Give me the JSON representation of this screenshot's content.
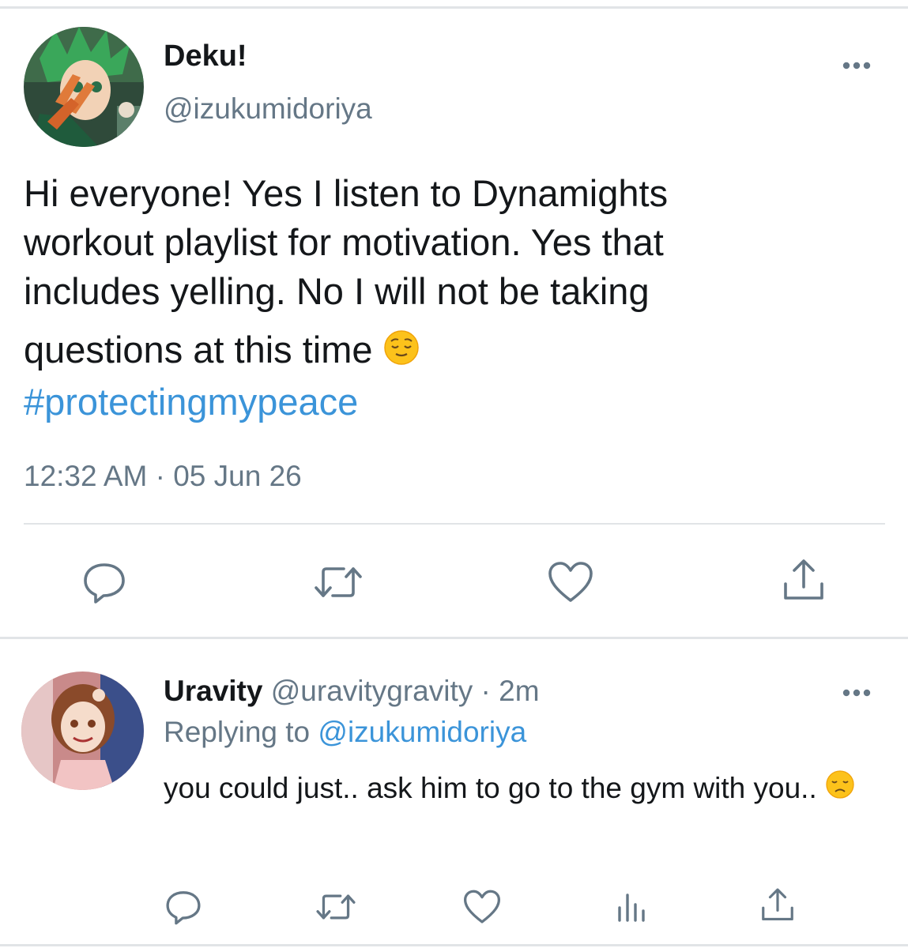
{
  "main_tweet": {
    "display_name": "Deku!",
    "handle": "@izukumidoriya",
    "text_lines": [
      "Hi everyone! Yes I listen to Dynamights",
      "workout playlist for motivation. Yes that",
      "includes yelling. No I will not be taking",
      "questions at this time"
    ],
    "emoji": "relieved-face-emoji",
    "hashtag": "#protectingmypeace",
    "timestamp": "12:32 AM · 05 Jun 26",
    "actions": [
      "reply-icon",
      "retweet-icon",
      "like-icon",
      "share-icon"
    ],
    "more_icon": "more-options-icon"
  },
  "reply_tweet": {
    "display_name": "Uravity",
    "handle": "@uravitygravity",
    "separator": "·",
    "time_ago": "2m",
    "replying_to_label": "Replying to",
    "replying_to_handle": "@izukumidoriya",
    "text": "you could just.. ask him to go to the gym with you..",
    "emoji": "disappointed-face-emoji",
    "actions": [
      "reply-icon",
      "retweet-icon",
      "like-icon",
      "analytics-icon",
      "share-icon"
    ],
    "more_icon": "more-options-icon"
  },
  "colors": {
    "text": "#14171a",
    "muted": "#657786",
    "link": "#3b94d9",
    "divider": "#e1e4e7",
    "icon": "#657786"
  }
}
